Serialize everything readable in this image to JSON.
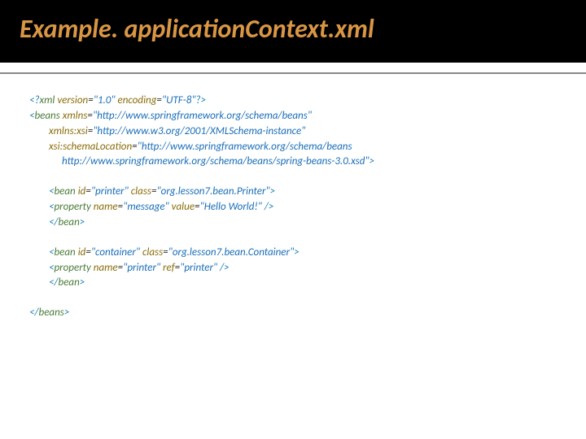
{
  "header": {
    "title": "Example. applicationContext.xml"
  },
  "code": {
    "l1": {
      "open": "<?",
      "tag": "xml",
      "a1": " version",
      "eq1": "=",
      "v1": "\"1.0\"",
      "a2": " encoding",
      "eq2": "=",
      "v2": "\"UTF-8\"",
      "close": "?>"
    },
    "l2": {
      "open": "<",
      "tag": "beans",
      "a1": " xmlns",
      "eq1": "=",
      "v1": "\"http://www.springframework.org/schema/beans\""
    },
    "l3": {
      "a1": "xmlns:xsi",
      "eq1": "=",
      "v1": "\"http://www.w3.org/2001/XMLSchema-instance\""
    },
    "l4": {
      "a1": "xsi:schemaLocation",
      "eq1": "=",
      "v1": "\"http://www.springframework.org/schema/beans"
    },
    "l5": {
      "v1": "http://www.springframework.org/schema/beans/spring-beans-3.0.xsd\"",
      "close": ">"
    },
    "l6": {
      "open": "<",
      "tag": "bean",
      "a1": " id",
      "eq1": "=",
      "v1": "\"printer\"",
      "a2": " class",
      "eq2": "=",
      "v2": "\"org.lesson7.bean.Printer\"",
      "close": ">"
    },
    "l7": {
      "open": "<",
      "tag": "property",
      "a1": " name",
      "eq1": "=",
      "v1": "\"message\"",
      "a2": " value",
      "eq2": "=",
      "v2": "\"Hello World!\"",
      "close": " />"
    },
    "l8": {
      "open": "</",
      "tag": "bean",
      "close": ">"
    },
    "l9": {
      "open": "<",
      "tag": "bean",
      "a1": " id",
      "eq1": "=",
      "v1": "\"container\"",
      "a2": " class",
      "eq2": "=",
      "v2": "\"org.lesson7.bean.Container\"",
      "close": ">"
    },
    "l10": {
      "open": "<",
      "tag": "property",
      "a1": " name",
      "eq1": "=",
      "v1": "\"printer\"",
      "a2": " ref",
      "eq2": "=",
      "v2": "\"printer\"",
      "close": " />"
    },
    "l11": {
      "open": "</",
      "tag": "bean",
      "close": ">"
    },
    "l12": {
      "open": "</",
      "tag": "beans",
      "close": ">"
    }
  }
}
